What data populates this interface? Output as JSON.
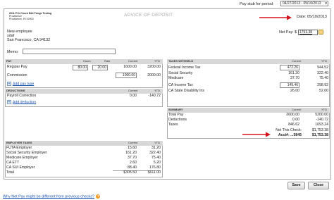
{
  "top": {
    "pay_stub_label": "Pay stub for period:",
    "period_value": "04/27/2013 - 05/10/2013"
  },
  "stub": {
    "company_lines": [
      "2011 P11 Check Edit Fringe Testing",
      "Providence",
      "Providence, RI 02903"
    ],
    "advice_title": "ADVICE OF DEPOSIT",
    "date_label": "Date: 05/10/2013",
    "employee_lines": [
      "New employee",
      "sdaf",
      "San Francisco, CA 94132"
    ],
    "net_pay_label": "Net Pay: $",
    "net_pay_value": "1753.38",
    "memo_label": "Memo:",
    "memo_value": ""
  },
  "pay": {
    "header": "PAY",
    "col_hours": "Hours",
    "col_rate": "Rate",
    "col_current": "Current",
    "col_ytd": "YTD",
    "rows": [
      {
        "label": "Regular Pay",
        "hours": "80.00",
        "rate": "20.00",
        "current": "1600.00",
        "ytd": "3200.00"
      },
      {
        "label": "Commission",
        "hours": "",
        "rate": "",
        "current": "1000.00",
        "ytd": "2000.00"
      }
    ],
    "add_link": "Add pay type"
  },
  "deductions": {
    "header": "DEDUCTIONS",
    "col_current": "Current",
    "col_ytd": "YTD",
    "rows": [
      {
        "label": "Payroll Correction",
        "current": "0.00",
        "ytd": "-140.72"
      }
    ],
    "add_link": "Add deduction"
  },
  "taxes": {
    "header": "TAXES WITHHELD",
    "col_current": "Current",
    "col_ytd": "YTD",
    "rows": [
      {
        "label": "Federal Income Tax",
        "current": "472.26",
        "ytd": "944.52"
      },
      {
        "label": "Social Security",
        "current": "161.20",
        "ytd": "322.40"
      },
      {
        "label": "Medicare",
        "current": "37.70",
        "ytd": "75.40"
      },
      {
        "label": "CA Income Tax",
        "current": "149.46",
        "ytd": "298.92"
      },
      {
        "label": "CA State Disability Ins",
        "current": "26.00",
        "ytd": "52.00"
      }
    ]
  },
  "summary": {
    "header": "SUMMARY",
    "col_current": "Current",
    "col_ytd": "YTD",
    "rows": [
      {
        "label": "Total Pay",
        "current": "2600.00",
        "ytd": "5200.00"
      },
      {
        "label": "Deductions",
        "current": "0.00",
        "ytd": "-140.72"
      },
      {
        "label": "Taxes",
        "current": "846.62",
        "ytd": "1693.24"
      }
    ],
    "net_check_label": "Net This Check:",
    "net_check_value": "$1,753.38",
    "acct_label": "Acct#: ...5845",
    "acct_value": "$1,753.38"
  },
  "employer_taxes": {
    "header": "EMPLOYER TAXES",
    "col_current": "Current",
    "col_ytd": "YTD",
    "rows": [
      {
        "label": "FUTA Employer",
        "current": "15.60",
        "ytd": "31.20"
      },
      {
        "label": "Social Security Employer",
        "current": "161.20",
        "ytd": "322.40"
      },
      {
        "label": "Medicare Employer",
        "current": "37.70",
        "ytd": "75.40"
      },
      {
        "label": "CA ETT",
        "current": "2.60",
        "ytd": "5.20"
      },
      {
        "label": "CA SUI Employer",
        "current": "88.40",
        "ytd": "176.80"
      }
    ],
    "total_label": "Total",
    "total_current": "$305.50",
    "total_ytd": "$611.00"
  },
  "actions": {
    "save": "Save",
    "close": "Close"
  },
  "footer": {
    "help_link": "Why Net Pay might be different from previous checks?"
  },
  "colors": {
    "arrow": "#d4121b",
    "header_bg": "#d8d8d8",
    "link": "#1a55b4",
    "help_icon": "#f39a1f"
  }
}
